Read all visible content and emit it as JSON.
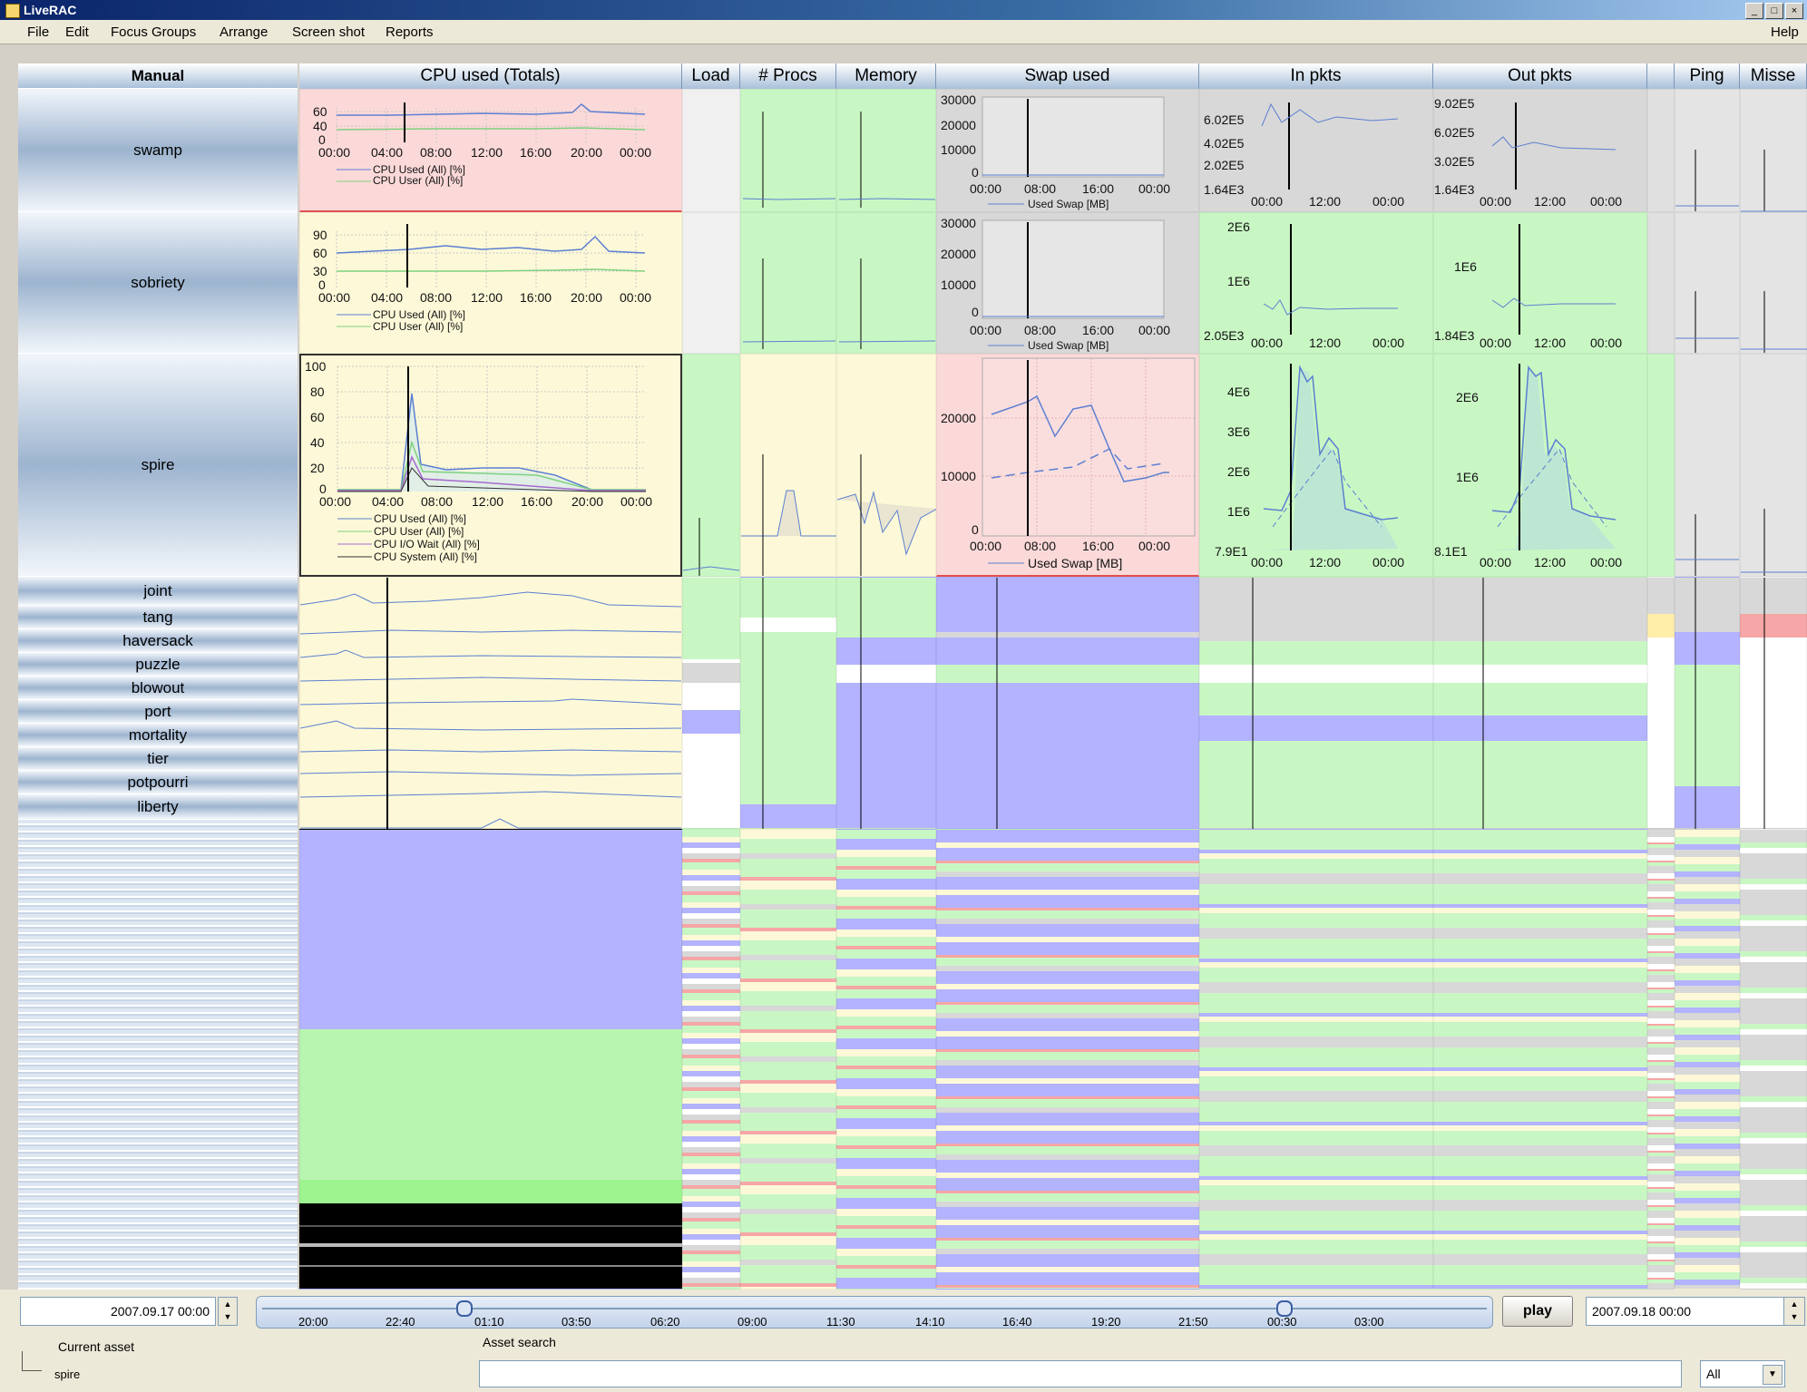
{
  "window": {
    "title": "LiveRAC",
    "controls": [
      "_",
      "□",
      "×"
    ]
  },
  "menu": {
    "items": [
      "File",
      "Edit",
      "Focus Groups",
      "Arrange",
      "Screen shot",
      "Reports"
    ],
    "help": "Help"
  },
  "grid": {
    "corner_label": "Manual",
    "columns": [
      "CPU used (Totals)",
      "Load",
      "# Procs",
      "Memory",
      "Swap used",
      "In pkts",
      "Out pkts",
      "Ping",
      "Misse"
    ],
    "rows": [
      "swamp",
      "sobriety",
      "spire",
      "joint",
      "tang",
      "haversack",
      "puzzle",
      "blowout",
      "port",
      "mortality",
      "tier",
      "potpourri",
      "liberty"
    ]
  },
  "charts": {
    "cpu_ticks": [
      "00:00",
      "04:00",
      "08:00",
      "12:00",
      "16:00",
      "20:00",
      "00:00"
    ],
    "swamp_cpu_y": [
      "60",
      "40",
      "0"
    ],
    "swamp_cpu_legend": [
      "CPU Used (All) [%]",
      "CPU User (All) [%]"
    ],
    "sobriety_cpu_y": [
      "90",
      "60",
      "30",
      "0"
    ],
    "sobriety_cpu_legend": [
      "CPU Used (All) [%]",
      "CPU User (All) [%]"
    ],
    "spire_cpu_y": [
      "100",
      "80",
      "60",
      "40",
      "20",
      "0"
    ],
    "spire_cpu_legend": [
      "CPU Used (All) [%]",
      "CPU User (All) [%]",
      "CPU I/O Wait (All) [%]",
      "CPU System (All) [%]"
    ],
    "swap_ticks": [
      "00:00",
      "08:00",
      "16:00",
      "00:00"
    ],
    "swap_y_top": [
      "30000",
      "20000",
      "10000",
      "0"
    ],
    "swap_y_spire": [
      "20000",
      "10000",
      "0"
    ],
    "swap_legend": "Used Swap [MB]",
    "pkt_ticks": [
      "00:00",
      "12:00",
      "00:00"
    ],
    "inpkts_swamp_y": [
      "6.02E5",
      "4.02E5",
      "2.02E5",
      "1.64E3"
    ],
    "outpkts_swamp_y": [
      "9.02E5",
      "6.02E5",
      "3.02E5",
      "1.64E3"
    ],
    "inpkts_sobriety_y": [
      "2E6",
      "1E6",
      "2.05E3"
    ],
    "outpkts_sobriety_y": [
      "1E6",
      "1.84E3"
    ],
    "inpkts_spire_y": [
      "4E6",
      "3E6",
      "2E6",
      "1E6",
      "7.9E1"
    ],
    "outpkts_spire_y": [
      "2E6",
      "1E6",
      "8.1E1"
    ]
  },
  "bottom": {
    "start_date": "2007.09.17 00:00",
    "end_date": "2007.09.18 00:00",
    "timeline_ticks": [
      "20:00",
      "22:40",
      "01:10",
      "03:50",
      "06:20",
      "09:00",
      "11:30",
      "14:10",
      "16:40",
      "19:20",
      "21:50",
      "00:30",
      "03:00"
    ],
    "play_label": "play",
    "current_asset_label": "Current asset",
    "current_asset_value": "spire",
    "asset_search_label": "Asset search",
    "asset_search_value": "",
    "filter_value": "All"
  },
  "colors": {
    "red_bg": "#fcd9d9",
    "yellow_bg": "#fdf9d8",
    "green_bg": "#c9f7c4",
    "purple_bg": "#b3b3ff",
    "gray_bg": "#d8d8d8",
    "series_blue": "#5b7fd1",
    "series_green": "#7fd17f"
  }
}
